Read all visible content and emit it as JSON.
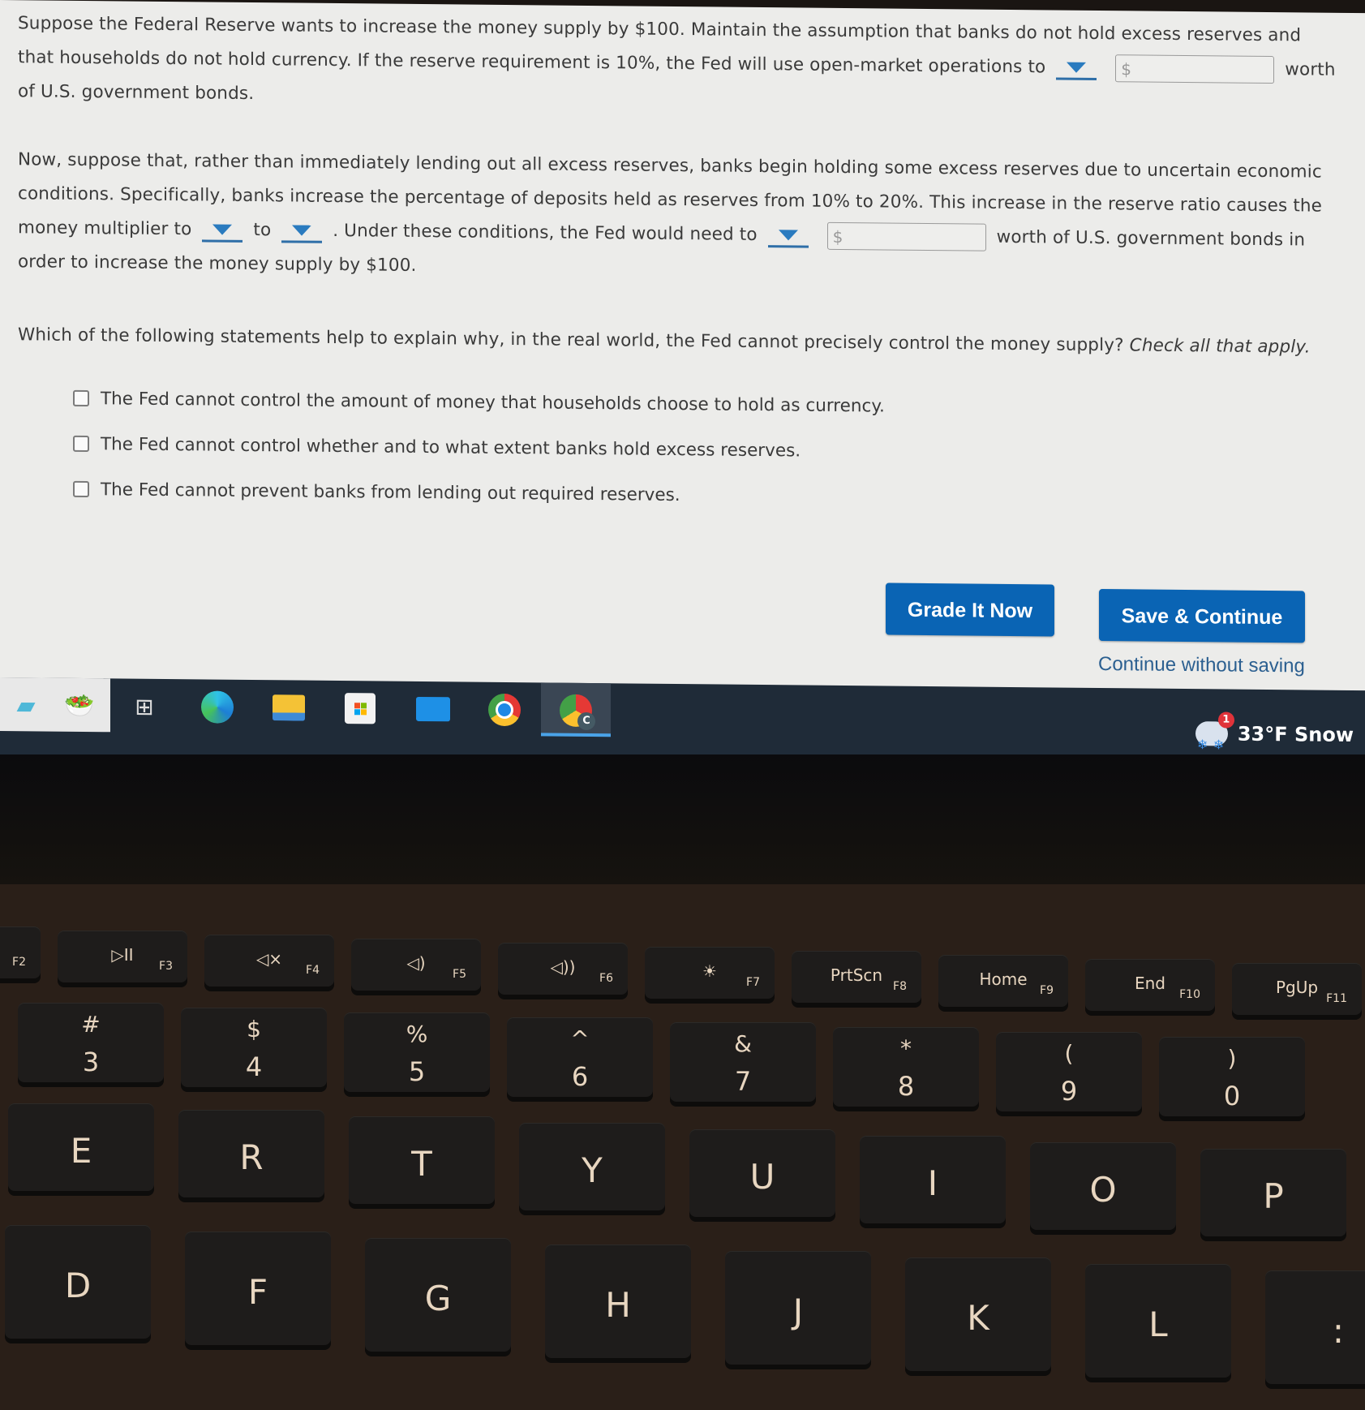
{
  "question": {
    "p1": {
      "text_a": "Suppose the Federal Reserve wants to increase the money supply by $100. Maintain the assumption that banks do not hold excess reserves and that households do not hold currency. If the reserve requirement is 10%, the Fed will use open-market operations to",
      "dropdown_value": "",
      "field_prefix": "$",
      "field_value": "",
      "text_b": "worth of U.S. government bonds."
    },
    "p2": {
      "text_a": "Now, suppose that, rather than immediately lending out all excess reserves, banks begin holding some excess reserves due to uncertain economic conditions. Specifically, banks increase the percentage of deposits held as reserves from 10% to 20%. This increase in the reserve ratio causes the money multiplier to",
      "dropdown1_value": "",
      "to_label": "to",
      "dropdown2_value": "",
      "text_b": ". Under these conditions, the Fed would need to",
      "dropdown3_value": "",
      "field_prefix": "$",
      "field_value": "",
      "text_c": "worth of U.S. government bonds in order to increase the money supply by $100."
    },
    "p3": {
      "prompt": "Which of the following statements help to explain why, in the real world, the Fed cannot precisely control the money supply?",
      "instruction": "Check all that apply.",
      "options": [
        {
          "label": "The Fed cannot control the amount of money that households choose to hold as currency.",
          "checked": false
        },
        {
          "label": "The Fed cannot control whether and to what extent banks hold excess reserves.",
          "checked": false
        },
        {
          "label": "The Fed cannot prevent banks from lending out required reserves.",
          "checked": false
        }
      ]
    }
  },
  "actions": {
    "grade_label": "Grade It Now",
    "save_label": "Save & Continue",
    "continue_label": "Continue without saving"
  },
  "taskbar": {
    "icons": [
      "widget-icon",
      "food-icon",
      "task-view-icon",
      "edge-icon",
      "file-explorer-icon",
      "store-icon",
      "mail-icon",
      "chrome-icon",
      "chrome-profile-icon"
    ],
    "active_profile_letter": "C",
    "weather": {
      "temp": "33°F",
      "condition": "Snow",
      "badge": "1"
    }
  },
  "keyboard": {
    "fkeys": [
      {
        "main": "",
        "sub": "F2"
      },
      {
        "main": "▷II",
        "sub": "F3"
      },
      {
        "main": "◁×",
        "sub": "F4"
      },
      {
        "main": "◁)",
        "sub": "F5"
      },
      {
        "main": "◁))",
        "sub": "F6"
      },
      {
        "main": "☀",
        "sub": "F7"
      },
      {
        "main": "PrtScn",
        "sub": "F8"
      },
      {
        "main": "Home",
        "sub": "F9"
      },
      {
        "main": "End",
        "sub": "F10"
      },
      {
        "main": "PgUp",
        "sub": "F11"
      }
    ],
    "numkeys": [
      {
        "top": "#",
        "bot": "3"
      },
      {
        "top": "$",
        "bot": "4"
      },
      {
        "top": "%",
        "bot": "5"
      },
      {
        "top": "^",
        "bot": "6"
      },
      {
        "top": "&",
        "bot": "7"
      },
      {
        "top": "*",
        "bot": "8"
      },
      {
        "top": "(",
        "bot": "9"
      },
      {
        "top": ")",
        "bot": "0"
      }
    ],
    "row_top": [
      "E",
      "R",
      "T",
      "Y",
      "U",
      "I",
      "O",
      "P"
    ],
    "row_home": [
      "D",
      "F",
      "G",
      "H",
      "J",
      "K",
      "L",
      ":"
    ]
  }
}
